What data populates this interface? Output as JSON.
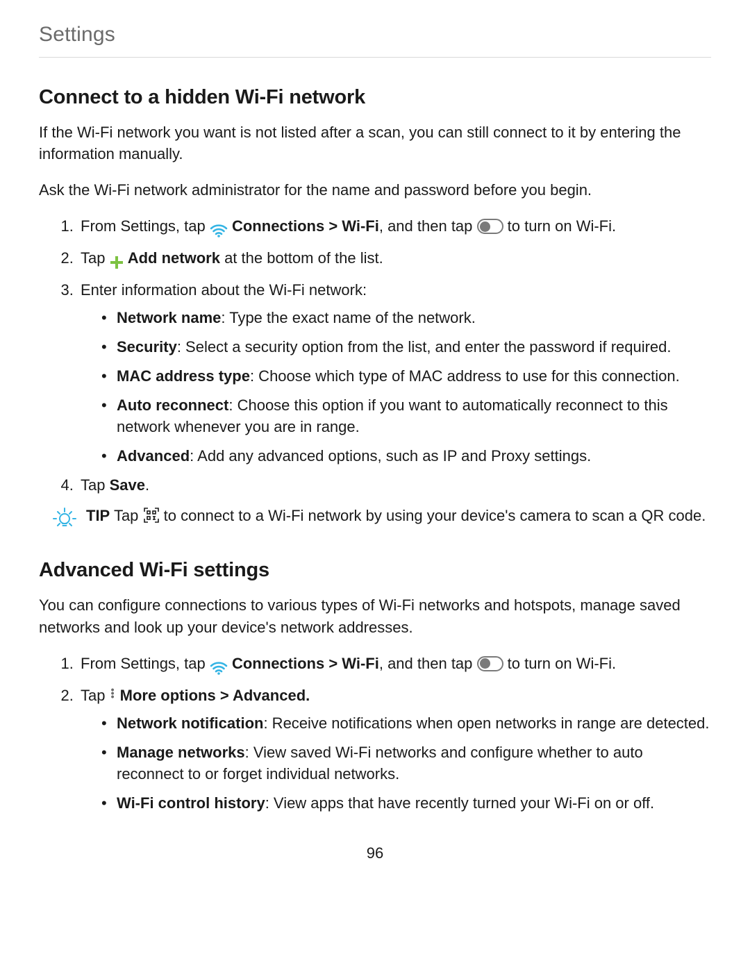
{
  "header": "Settings",
  "page_number": "96",
  "section1": {
    "heading": "Connect to a hidden Wi-Fi network",
    "intro1": "If the Wi-Fi network you want is not listed after a scan, you can still connect to it by entering the information manually.",
    "intro2": "Ask the Wi-Fi network administrator for the name and password before you begin.",
    "step1_a": "From Settings, tap ",
    "step1_b": "Connections > Wi-Fi",
    "step1_c": ", and then tap ",
    "step1_d": " to turn on Wi-Fi.",
    "step2_a": "Tap ",
    "step2_b": "Add network",
    "step2_c": " at the bottom of the list.",
    "step3": "Enter information about the Wi-Fi network:",
    "b1_label": "Network name",
    "b1_text": ": Type the exact name of the network.",
    "b2_label": "Security",
    "b2_text": ": Select a security option from the list, and enter the password if required.",
    "b3_label": "MAC address type",
    "b3_text": ": Choose which type of MAC address to use for this connection.",
    "b4_label": "Auto reconnect",
    "b4_text": ": Choose this option if you want to automatically reconnect to this network whenever you are in range.",
    "b5_label": "Advanced",
    "b5_text": ": Add any advanced options, such as IP and Proxy settings.",
    "step4_a": "Tap ",
    "step4_b": "Save",
    "step4_c": ".",
    "tip_label": "TIP",
    "tip_a": "  Tap ",
    "tip_b": " to connect to a Wi-Fi network by using your device's camera to scan a QR code."
  },
  "section2": {
    "heading": "Advanced Wi-Fi settings",
    "intro": "You can configure connections to various types of Wi-Fi networks and hotspots, manage saved networks and look up your device's network addresses.",
    "step1_a": "From Settings, tap ",
    "step1_b": "Connections > Wi-Fi",
    "step1_c": ", and then tap ",
    "step1_d": " to turn on Wi-Fi.",
    "step2_a": "Tap ",
    "step2_b": "More options > Advanced.",
    "b1_label": "Network notification",
    "b1_text": ": Receive notifications when open networks in range are detected.",
    "b2_label": "Manage networks",
    "b2_text": ": View saved Wi-Fi networks and configure whether to auto reconnect to or forget individual networks.",
    "b3_label": "Wi-Fi control history",
    "b3_text": ": View apps that have recently turned your Wi-Fi on or off."
  }
}
